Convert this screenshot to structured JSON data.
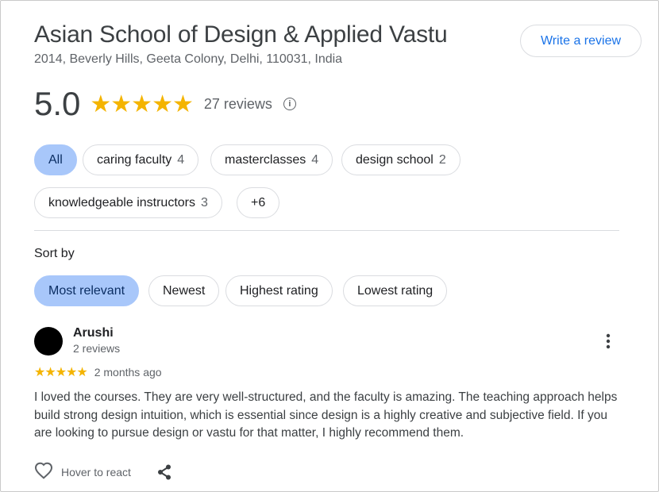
{
  "place": {
    "title": "Asian School of Design & Applied Vastu",
    "address": "2014, Beverly Hills, Geeta Colony, Delhi, 110031, India",
    "write_review_label": "Write a review"
  },
  "rating": {
    "value": "5.0",
    "stars": "★★★★★",
    "review_count": "27 reviews",
    "star_color": "#f4b400"
  },
  "topics": [
    {
      "label": "All",
      "count": "",
      "active": true
    },
    {
      "label": "caring faculty",
      "count": "4"
    },
    {
      "label": "masterclasses",
      "count": "4"
    },
    {
      "label": "design school",
      "count": "2"
    },
    {
      "label": "knowledgeable instructors",
      "count": "3"
    },
    {
      "label": "+6",
      "count": ""
    }
  ],
  "sort": {
    "label": "Sort by",
    "options": [
      "Most relevant",
      "Newest",
      "Highest rating",
      "Lowest rating"
    ],
    "selected": "Most relevant"
  },
  "review": {
    "name": "Arushi",
    "meta": "2 reviews",
    "stars": "★★★★★",
    "date": "2 months ago",
    "text": "I loved the courses. They are very well-structured, and the faculty is amazing. The teaching approach helps build strong design intuition, which is essential since design is a highly creative and subjective field. If you are looking to pursue design or vastu for that matter, I highly recommend them.",
    "react_label": "Hover to react",
    "icons": [
      "more-vert-icon",
      "heart-icon",
      "share-icon"
    ]
  },
  "colors": {
    "accent": "#1a73e8",
    "chip_active": "#a8c7fa"
  }
}
